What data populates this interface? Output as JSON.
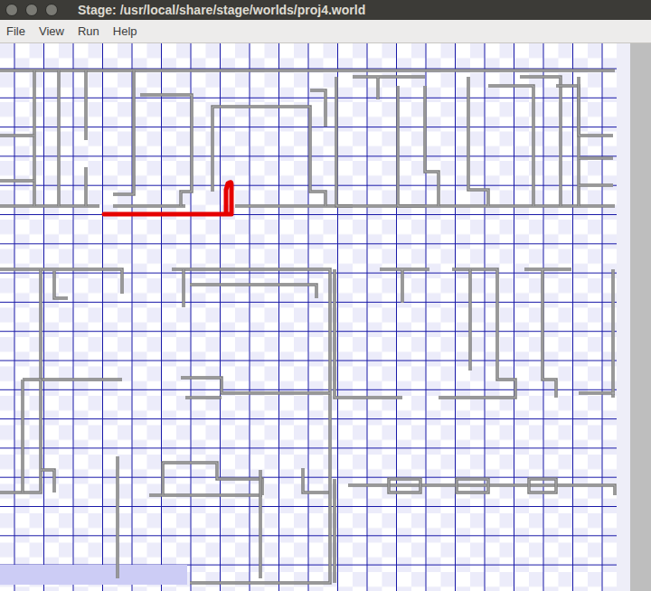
{
  "window": {
    "title": "Stage: /usr/local/share/stage/worlds/proj4.world"
  },
  "menu": [
    "File",
    "View",
    "Run",
    "Help"
  ]
}
